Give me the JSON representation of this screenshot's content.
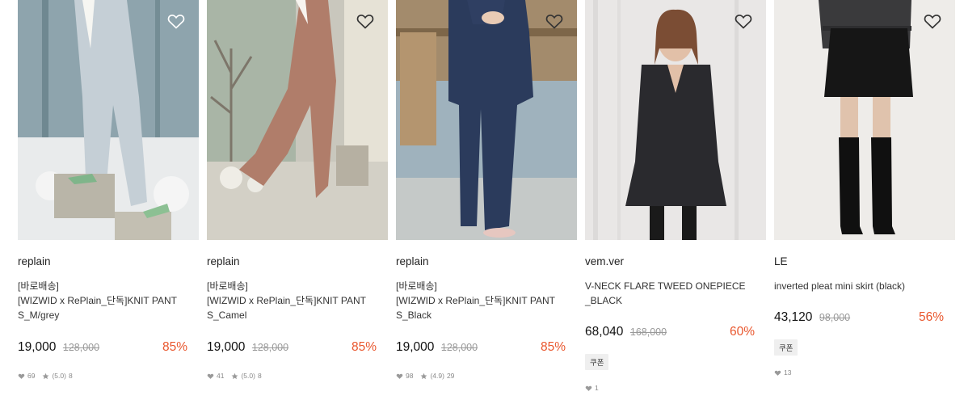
{
  "products": [
    {
      "brand": "replain",
      "tag": "[바로배송]",
      "name_line1": "[WIZWID x RePlain_단독]KNIT PANT",
      "name_line2": "S_M/grey",
      "price": "19,000",
      "original_price": "128,000",
      "discount": "85%",
      "coupon": "",
      "likes": "69",
      "rating": "(5.0)",
      "reviews": "8"
    },
    {
      "brand": "replain",
      "tag": "[바로배송]",
      "name_line1": "[WIZWID x RePlain_단독]KNIT PANT",
      "name_line2": "S_Camel",
      "price": "19,000",
      "original_price": "128,000",
      "discount": "85%",
      "coupon": "",
      "likes": "41",
      "rating": "(5.0)",
      "reviews": "8"
    },
    {
      "brand": "replain",
      "tag": "[바로배송]",
      "name_line1": "[WIZWID x RePlain_단독]KNIT PANT",
      "name_line2": "S_Black",
      "price": "19,000",
      "original_price": "128,000",
      "discount": "85%",
      "coupon": "",
      "likes": "98",
      "rating": "(4.9)",
      "reviews": "29"
    },
    {
      "brand": "vem.ver",
      "tag": "",
      "name_line1": "V-NECK FLARE TWEED ONEPIECE",
      "name_line2": "_BLACK",
      "price": "68,040",
      "original_price": "168,000",
      "discount": "60%",
      "coupon": "쿠폰",
      "likes": "1",
      "rating": "",
      "reviews": ""
    },
    {
      "brand": "LE",
      "tag": "",
      "name_line1": "inverted pleat mini skirt (black)",
      "name_line2": "",
      "price": "43,120",
      "original_price": "98,000",
      "discount": "56%",
      "coupon": "쿠폰",
      "likes": "13",
      "rating": "",
      "reviews": ""
    }
  ],
  "icons": {
    "wishlist": "heart-outline-icon",
    "likes": "heart-filled-icon",
    "rating": "star-icon"
  },
  "colors": {
    "discount": "#e9572e",
    "strike": "#999999",
    "coupon_bg": "#efefef"
  }
}
